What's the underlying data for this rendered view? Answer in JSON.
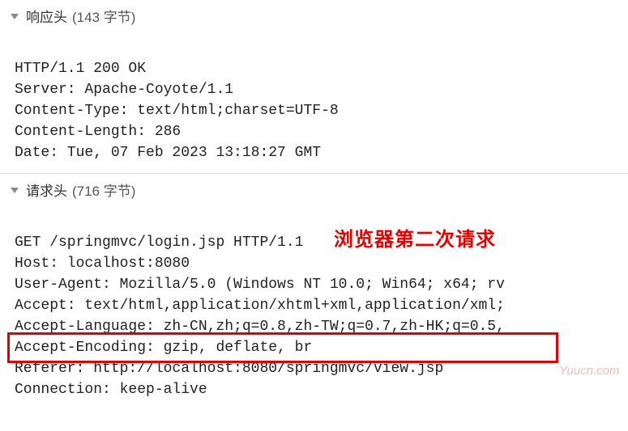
{
  "sections": {
    "response": {
      "title": "响应头",
      "meta": "(143 字节)",
      "lines": [
        "HTTP/1.1 200 OK",
        "Server: Apache-Coyote/1.1",
        "Content-Type: text/html;charset=UTF-8",
        "Content-Length: 286",
        "Date: Tue, 07 Feb 2023 13:18:27 GMT"
      ]
    },
    "request": {
      "title": "请求头",
      "meta": "(716 字节)",
      "lines": [
        "GET /springmvc/login.jsp HTTP/1.1",
        "Host: localhost:8080",
        "User-Agent: Mozilla/5.0 (Windows NT 10.0; Win64; x64; rv",
        "Accept: text/html,application/xhtml+xml,application/xml;",
        "Accept-Language: zh-CN,zh;q=0.8,zh-TW;q=0.7,zh-HK;q=0.5,",
        "Accept-Encoding: gzip, deflate, br",
        "Referer: http://localhost:8080/springmvc/view.jsp",
        "Connection: keep-alive"
      ]
    }
  },
  "annotation": "浏览器第二次请求",
  "watermark": "Yuucn.com",
  "icons": {
    "expanded": "expanded-triangle"
  }
}
